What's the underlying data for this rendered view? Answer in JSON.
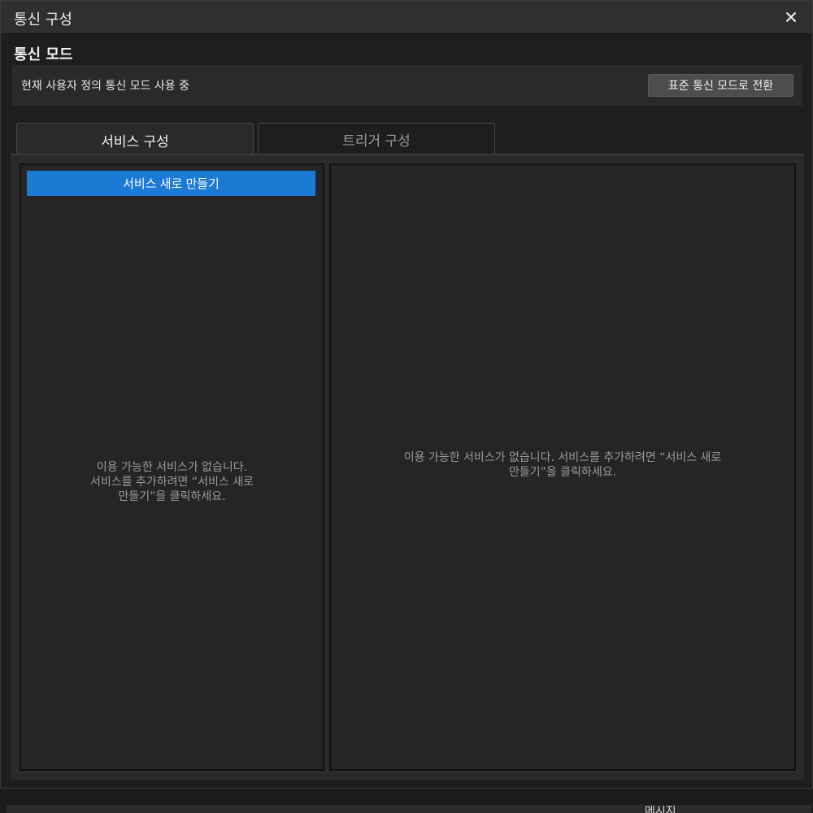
{
  "window": {
    "title": "통신 구성",
    "close_icon": "close-icon"
  },
  "mode_section": {
    "heading": "통신 모드",
    "status": "현재 사용자 정의 통신 모드 사용 중",
    "switch_button": "표준 통신 모드로 전환"
  },
  "tabs": [
    {
      "label": "서비스 구성",
      "active": true
    },
    {
      "label": "트리거 구성",
      "active": false
    }
  ],
  "service_list": {
    "new_button": "서비스 새로 만들기",
    "empty_line1": "이용 가능한 서비스가 없습니다.",
    "empty_line2": "서비스를 추가하려면 “서비스 새로",
    "empty_line3": "만들기”을 클릭하세요."
  },
  "detail_panel": {
    "empty_line1": "이용 가능한 서비스가 없습니다. 서비스를 추가하려면 “서비스 새로",
    "empty_line2": "만들기”을 클릭하세요."
  },
  "background": {
    "partial_label": "메시지"
  },
  "colors": {
    "accent": "#1a7ad4",
    "background": "#1e1e1e",
    "titlebar": "#2f2f2f"
  }
}
